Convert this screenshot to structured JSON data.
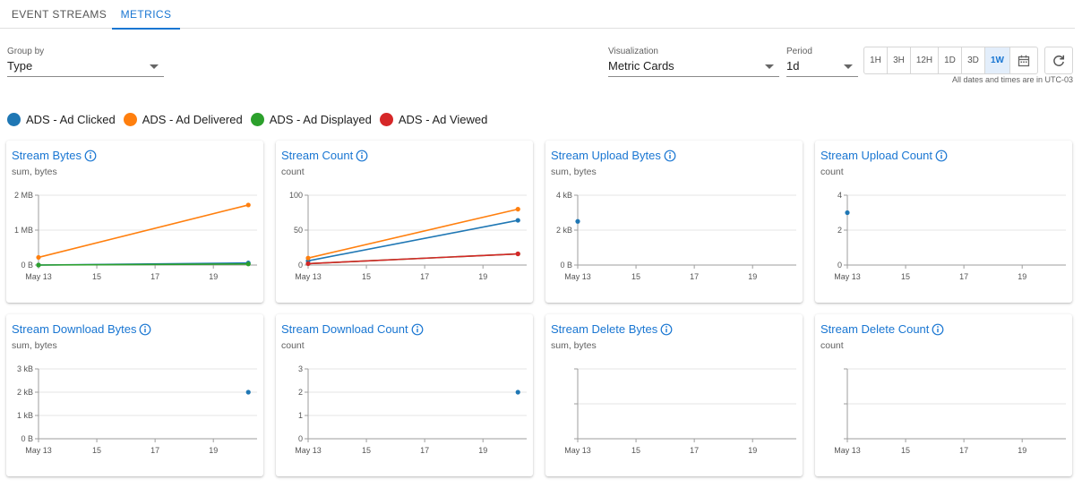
{
  "tabs": [
    {
      "label": "EVENT STREAMS",
      "active": false
    },
    {
      "label": "METRICS",
      "active": true
    }
  ],
  "controls": {
    "group_by": {
      "label": "Group by",
      "value": "Type"
    },
    "visualization": {
      "label": "Visualization",
      "value": "Metric Cards"
    },
    "period": {
      "label": "Period",
      "value": "1d"
    },
    "period_buttons": [
      "1H",
      "3H",
      "12H",
      "1D",
      "3D",
      "1W"
    ],
    "active_period": "1W",
    "timezone_note": "All dates and times are in UTC-03"
  },
  "legend": [
    {
      "label": "ADS - Ad Clicked",
      "color": "#1f77b4"
    },
    {
      "label": "ADS - Ad Delivered",
      "color": "#ff7f0e"
    },
    {
      "label": "ADS - Ad Displayed",
      "color": "#2ca02c"
    },
    {
      "label": "ADS - Ad Viewed",
      "color": "#d62728"
    }
  ],
  "chart_data": [
    {
      "type": "line",
      "title": "Stream Bytes",
      "subtitle": "sum, bytes",
      "x_ticks": [
        "May 13",
        "15",
        "17",
        "19"
      ],
      "y_ticks": [
        "0 B",
        "1 MB",
        "2 MB"
      ],
      "ylim": [
        0,
        2
      ],
      "series": [
        {
          "name": "ADS - Ad Clicked",
          "x": [
            13,
            20.2
          ],
          "values": [
            0,
            0.06
          ]
        },
        {
          "name": "ADS - Ad Delivered",
          "x": [
            13,
            20.2
          ],
          "values": [
            0.22,
            1.72
          ]
        },
        {
          "name": "ADS - Ad Displayed",
          "x": [
            13,
            20.2
          ],
          "values": [
            0,
            0.03
          ]
        }
      ]
    },
    {
      "type": "line",
      "title": "Stream Count",
      "subtitle": "count",
      "x_ticks": [
        "May 13",
        "15",
        "17",
        "19"
      ],
      "y_ticks": [
        "0",
        "50",
        "100"
      ],
      "ylim": [
        0,
        100
      ],
      "series": [
        {
          "name": "ADS - Ad Clicked",
          "x": [
            13,
            20.2
          ],
          "values": [
            6,
            64
          ]
        },
        {
          "name": "ADS - Ad Delivered",
          "x": [
            13,
            20.2
          ],
          "values": [
            10,
            80
          ]
        },
        {
          "name": "ADS - Ad Displayed",
          "x": [
            13,
            20.2
          ],
          "values": [
            2,
            16
          ]
        },
        {
          "name": "ADS - Ad Viewed",
          "x": [
            13,
            20.2
          ],
          "values": [
            2,
            16
          ]
        }
      ]
    },
    {
      "type": "scatter",
      "title": "Stream Upload Bytes",
      "subtitle": "sum, bytes",
      "x_ticks": [
        "May 13",
        "15",
        "17",
        "19"
      ],
      "y_ticks": [
        "0 B",
        "2 kB",
        "4 kB"
      ],
      "ylim": [
        0,
        4
      ],
      "series": [
        {
          "name": "ADS - Ad Clicked",
          "x": [
            13
          ],
          "values": [
            2.5
          ]
        }
      ]
    },
    {
      "type": "scatter",
      "title": "Stream Upload Count",
      "subtitle": "count",
      "x_ticks": [
        "May 13",
        "15",
        "17",
        "19"
      ],
      "y_ticks": [
        "0",
        "2",
        "4"
      ],
      "ylim": [
        0,
        4
      ],
      "series": [
        {
          "name": "ADS - Ad Clicked",
          "x": [
            13
          ],
          "values": [
            3
          ]
        }
      ]
    },
    {
      "type": "scatter",
      "title": "Stream Download Bytes",
      "subtitle": "sum, bytes",
      "x_ticks": [
        "May 13",
        "15",
        "17",
        "19"
      ],
      "y_ticks": [
        "0 B",
        "1 kB",
        "2 kB",
        "3 kB"
      ],
      "ylim": [
        0,
        3
      ],
      "series": [
        {
          "name": "ADS - Ad Clicked",
          "x": [
            20.2
          ],
          "values": [
            2
          ]
        }
      ]
    },
    {
      "type": "scatter",
      "title": "Stream Download Count",
      "subtitle": "count",
      "x_ticks": [
        "May 13",
        "15",
        "17",
        "19"
      ],
      "y_ticks": [
        "0",
        "1",
        "2",
        "3"
      ],
      "ylim": [
        0,
        3
      ],
      "series": [
        {
          "name": "ADS - Ad Clicked",
          "x": [
            20.2
          ],
          "values": [
            2
          ]
        }
      ]
    },
    {
      "type": "line",
      "title": "Stream Delete Bytes",
      "subtitle": "sum, bytes",
      "x_ticks": [
        "May 13",
        "15",
        "17",
        "19"
      ],
      "y_ticks": [
        "",
        "",
        ""
      ],
      "ylim": [
        0,
        1
      ],
      "series": []
    },
    {
      "type": "line",
      "title": "Stream Delete Count",
      "subtitle": "count",
      "x_ticks": [
        "May 13",
        "15",
        "17",
        "19"
      ],
      "y_ticks": [
        "",
        "",
        ""
      ],
      "ylim": [
        0,
        1
      ],
      "series": []
    }
  ]
}
